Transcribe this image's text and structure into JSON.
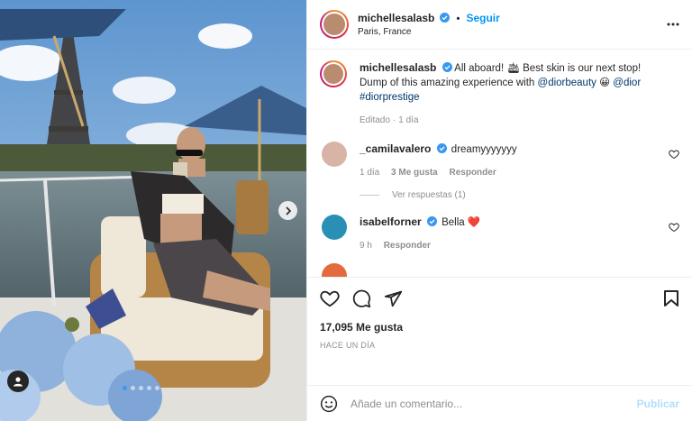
{
  "post": {
    "username": "michellesalasb",
    "follow_label": "Seguir",
    "dot": "•",
    "location": "Paris, France",
    "slide_count": 5,
    "active_slide": 1
  },
  "caption": {
    "username": "michellesalasb",
    "text_a": "All aboard! 🛳 Best skin is our next stop! Dump of this amazing experience with ",
    "mention_1": "@diorbeauty",
    "text_b": " 😀 ",
    "mention_2": "@dior",
    "hashtag": "#diorprestige",
    "edited": "Editado",
    "dot": "·",
    "time": "1 día"
  },
  "comments": [
    {
      "username": "_camilavalero",
      "text": "dreamyyyyyyy",
      "time": "1 día",
      "likes": "3 Me gusta",
      "reply": "Responder",
      "view_replies": "Ver respuestas (1)"
    },
    {
      "username": "isabelforner",
      "text": "Bella ",
      "emoji": "❤️",
      "time": "9 h",
      "reply": "Responder"
    }
  ],
  "actions": {
    "likes": "17,095 Me gusta",
    "date": "HACE UN DÍA"
  },
  "add_comment": {
    "placeholder": "Añade un comentario...",
    "publish": "Publicar"
  },
  "colors": {
    "link": "#0095f6",
    "mention": "#00376b",
    "muted": "#8e8e8e"
  }
}
